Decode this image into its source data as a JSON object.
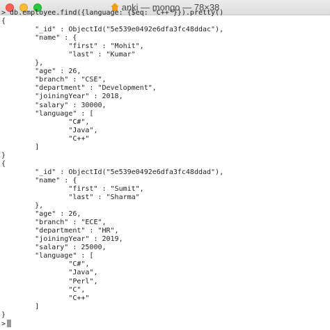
{
  "window": {
    "title": "anki — mongo — 78×38",
    "icon": "home-folder-icon"
  },
  "terminal": {
    "lines": [
      "> db.employee.find({language: {$eq: \"C++\"}}).pretty()",
      "{",
      "        \"_id\" : ObjectId(\"5e539e0492e6dfa3fc48ddac\"),",
      "        \"name\" : {",
      "                \"first\" : \"Mohit\",",
      "                \"last\" : \"Kumar\"",
      "        },",
      "        \"age\" : 26,",
      "        \"branch\" : \"CSE\",",
      "        \"department\" : \"Development\",",
      "        \"joiningYear\" : 2018,",
      "        \"salary\" : 30000,",
      "        \"language\" : [",
      "                \"C#\",",
      "                \"Java\",",
      "                \"C++\"",
      "        ]",
      "}",
      "{",
      "        \"_id\" : ObjectId(\"5e539e0492e6dfa3fc48ddad\"),",
      "        \"name\" : {",
      "                \"first\" : \"Sumit\",",
      "                \"last\" : \"Sharma\"",
      "        },",
      "        \"age\" : 26,",
      "        \"branch\" : \"ECE\",",
      "        \"department\" : \"HR\",",
      "        \"joiningYear\" : 2019,",
      "        \"salary\" : 25000,",
      "        \"language\" : [",
      "                \"C#\",",
      "                \"Java\",",
      "                \"Perl\",",
      "                \"C\",",
      "                \"C++\"",
      "        ]",
      "}"
    ],
    "prompt": ">"
  }
}
